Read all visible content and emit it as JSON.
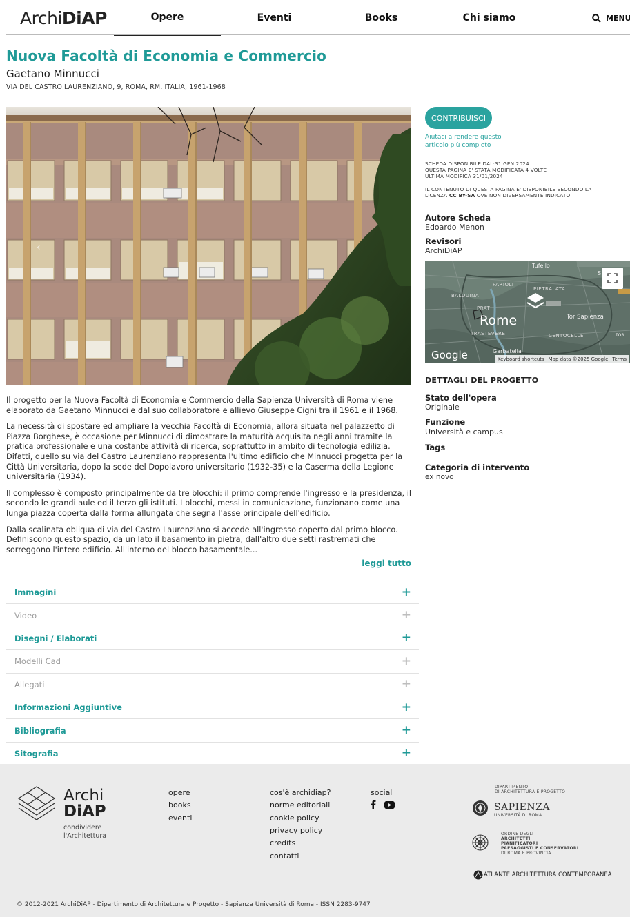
{
  "header": {
    "logo_light": "Archi",
    "logo_bold": "DiAP",
    "nav": [
      "Opere",
      "Eventi",
      "Books",
      "Chi siamo"
    ],
    "menu_label": "MENU"
  },
  "article": {
    "title": "Nuova Facoltà di Economia e Commercio",
    "architect": "Gaetano Minnucci",
    "location": "VIA DEL CASTRO LAURENZIANO, 9, ROMA, RM, ITALIA, 1961-1968",
    "paragraphs": [
      "Il progetto per la Nuova Facoltà di Economia e Commercio della Sapienza Università di Roma viene elaborato da Gaetano Minnucci e dal suo collaboratore e allievo Giuseppe Cigni tra il 1961 e il 1968.",
      "La necessità di spostare ed ampliare la vecchia Facoltà di Economia, allora situata nel palazzetto di Piazza Borghese, è occasione per Minnucci di dimostrare la maturità acquisita negli anni tramite la pratica professionale e una costante attività di ricerca, soprattutto in ambito di tecnologia edilizia. Difatti, quello su via del Castro Laurenziano rappresenta l'ultimo edificio che Minnucci progetta per la Città Universitaria, dopo la sede del Dopolavoro universitario (1932-35) e la Caserma della Legione universitaria (1934).",
      "Il complesso è composto principalmente da tre blocchi: il primo comprende l'ingresso e la presidenza, il secondo le grandi aule ed il terzo gli istituti. I blocchi, messi in comunicazione, funzionano come una lunga piazza coperta dalla forma allungata che segna l'asse principale dell'edificio.",
      "Dalla scalinata obliqua di via del Castro Laurenziano si accede all'ingresso coperto dal primo blocco. Definiscono questo spazio, da un lato il basamento in pietra, dall'altro due setti rastremati che sorreggono l'intero edificio. All'interno del blocco basamentale..."
    ],
    "read_more": "leggi tutto",
    "slider_prev": "‹"
  },
  "accordion": [
    {
      "label": "Immagini",
      "enabled": true
    },
    {
      "label": "Video",
      "enabled": false
    },
    {
      "label": "Disegni / Elaborati",
      "enabled": true
    },
    {
      "label": "Modelli Cad",
      "enabled": false
    },
    {
      "label": "Allegati",
      "enabled": false
    },
    {
      "label": "Informazioni Aggiuntive",
      "enabled": true
    },
    {
      "label": "Bibliografia",
      "enabled": true
    },
    {
      "label": "Sitografia",
      "enabled": true
    }
  ],
  "sidebar": {
    "contribute": "CONTRIBUISCI",
    "help": "Aiutaci a rendere questo articolo più completo",
    "meta_lines": [
      "SCHEDA DISPONIBILE DAL:31.GEN.2024",
      "QUESTA PAGINA E' STATA MODIFICATA 4 VOLTE",
      "ULTIMA MODIFICA 31/01/2024"
    ],
    "license_line1": "IL CONTENUTO DI QUESTA PAGINA E' DISPONIBILE SECONDO LA",
    "license_prefix": "LICENZA",
    "license_name": "CC BY-SA",
    "license_suffix": "OVE NON DIVERSAMENTE INDICATO",
    "author_label": "Autore Scheda",
    "author": "Edoardo Menon",
    "reviewers_label": "Revisori",
    "reviewers": "ArchiDiAP",
    "details_heading": "DETTAGLI DEL PROGETTO",
    "status_label": "Stato dell'opera",
    "status": "Originale",
    "function_label": "Funzione",
    "function": "Università e campus",
    "tags_label": "Tags",
    "category_label": "Categoria di intervento",
    "category": "ex novo"
  },
  "map": {
    "city": "Rome",
    "labels": [
      "Tufello",
      "PARIOLI",
      "PIETRALATA",
      "BALDUINA",
      "PRATI",
      "Tor Sapienza",
      "TRASTEVERE",
      "CENTOCELLE",
      "Garbatella",
      "S",
      "TOR"
    ],
    "provider": "Google",
    "shortcuts": "Keyboard shortcuts",
    "map_data": "Map data ©2025 Google",
    "terms": "Terms"
  },
  "footer": {
    "logo_light": "Archi",
    "logo_bold": "DiAP",
    "tagline_1": "condividere",
    "tagline_2": "l'Architettura",
    "col1": [
      "opere",
      "books",
      "eventi"
    ],
    "col2": [
      "cos'è archidiap?",
      "norme editoriali",
      "cookie policy",
      "privacy policy",
      "credits",
      "contatti"
    ],
    "social_label": "social",
    "dept_1": "DIPARTIMENTO",
    "dept_2": "DI ARCHITETTURA E PROGETTO",
    "sapienza": "SAPIENZA",
    "sapienza_sub": "UNIVERSITÀ DI ROMA",
    "ordine_1": "ORDINE DEGLI",
    "ordine_2": "ARCHITETTI",
    "ordine_3": "PIANIFICATORI",
    "ordine_4": "PAESAGGISTI E CONSERVATORI",
    "ordine_5": "DI ROMA E PROVINCIA",
    "atlante": "ATLANTE ARCHITETTURA CONTEMPORANEA",
    "copyright": "© 2012-2021 ArchiDiAP - Dipartimento di Architettura e Progetto - Sapienza Università di Roma - ISSN 2283-9747"
  },
  "colors": {
    "accent": "#1f9a97",
    "button": "#2aa39f",
    "footer_bg": "#ebebeb"
  }
}
